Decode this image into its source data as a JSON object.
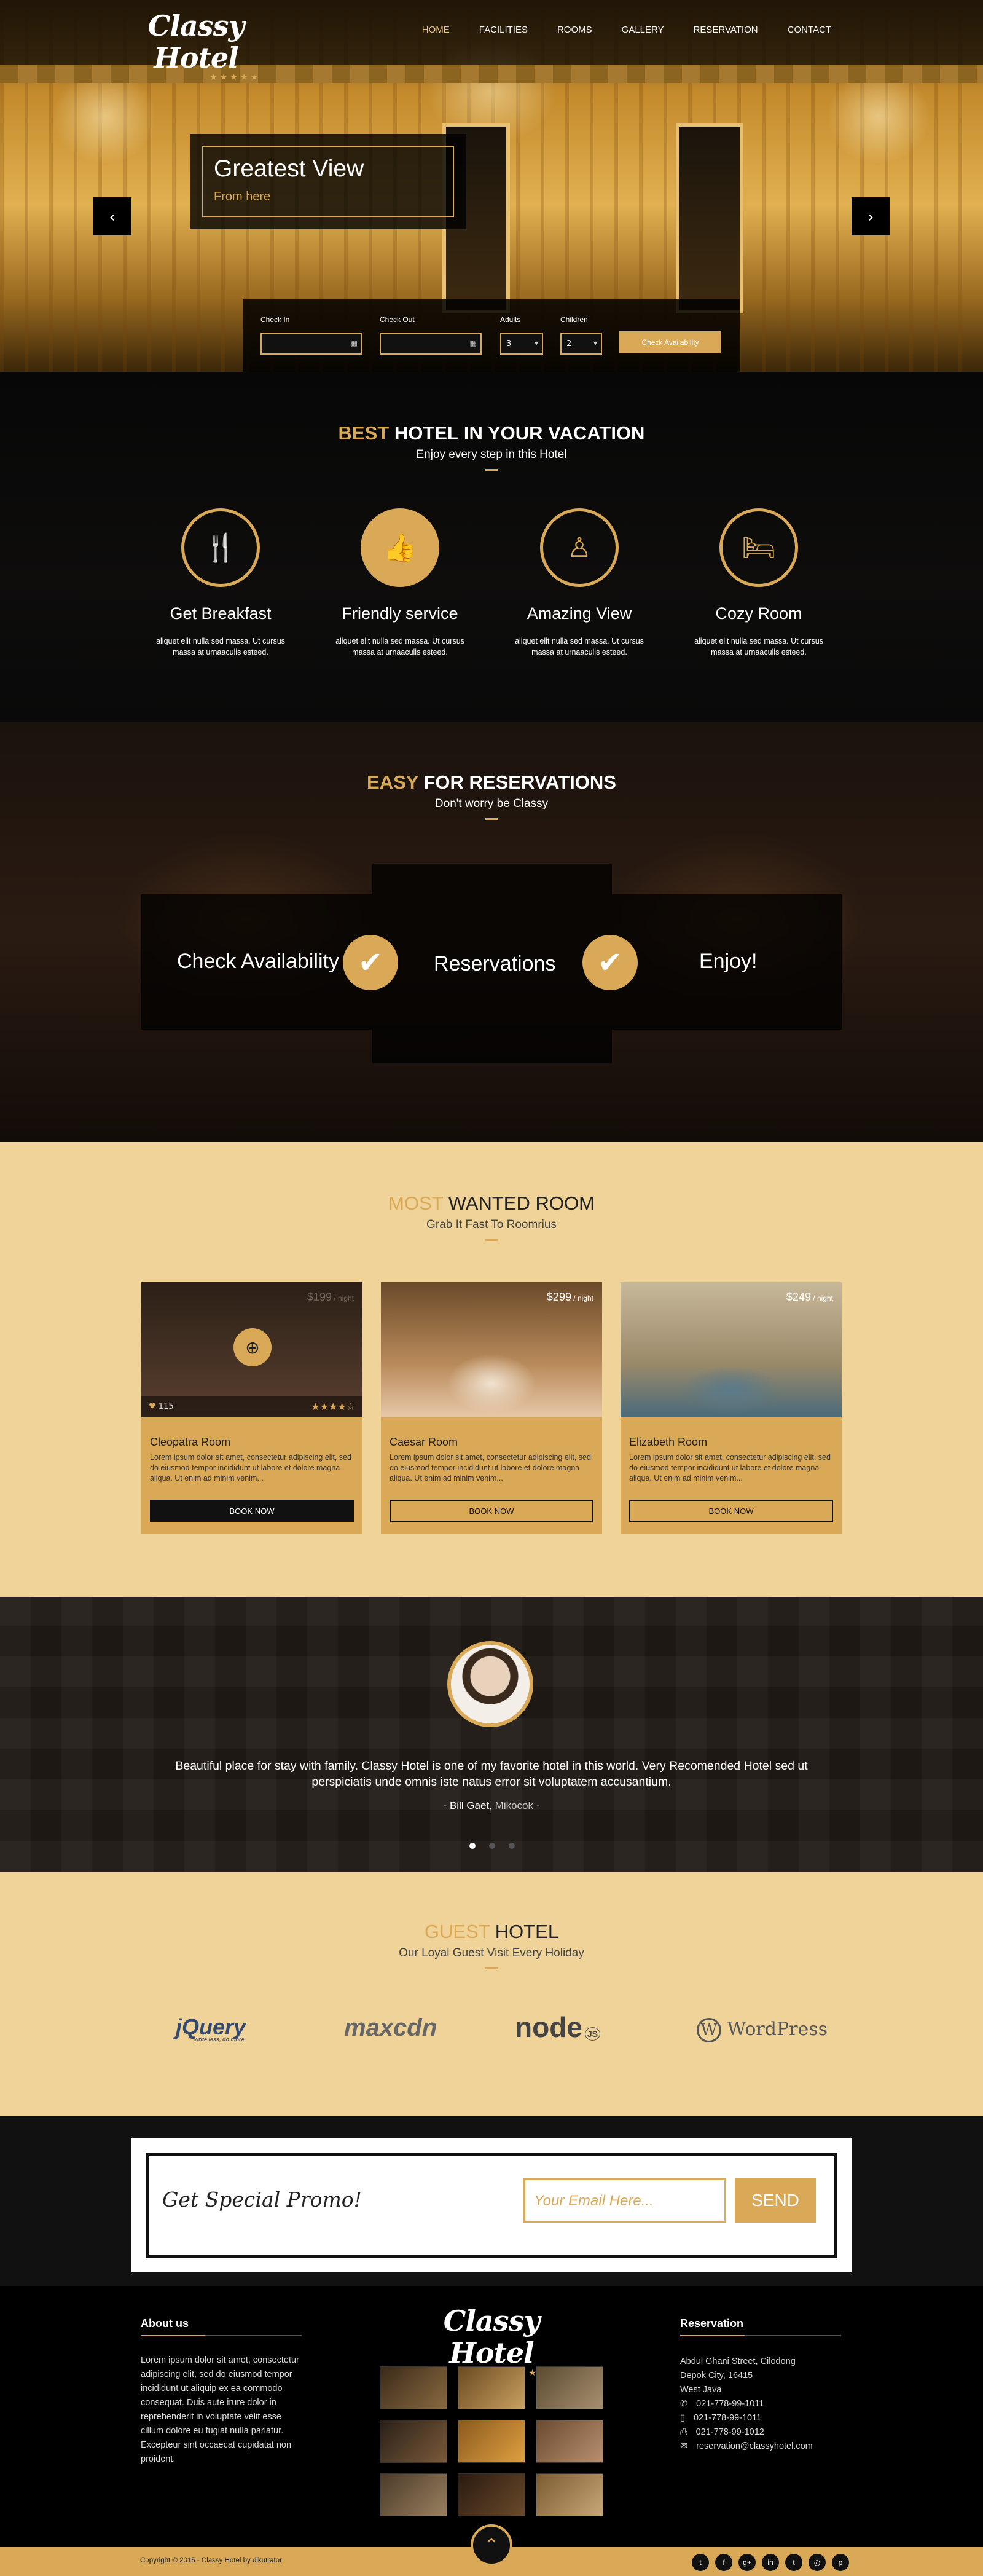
{
  "header": {
    "logo": "Classy Hotel",
    "logo_stars": "★★★★★",
    "nav": [
      "HOME",
      "FACILITIES",
      "ROOMS",
      "GALLERY",
      "RESERVATION",
      "CONTACT"
    ]
  },
  "hero": {
    "title": "Greatest View",
    "subtitle": "From here",
    "prev_icon": "‹",
    "next_icon": "›",
    "booking": {
      "checkin_label": "Check In",
      "checkout_label": "Check Out",
      "adults_label": "Adults",
      "adults_value": "3",
      "children_label": "Children",
      "children_value": "2",
      "button": "Check Availability"
    }
  },
  "best": {
    "title_accent": "BEST",
    "title_rest": " HOTEL IN YOUR VACATION",
    "subtitle": "Enjoy every step in this Hotel",
    "features": [
      {
        "icon": "cutlery-icon",
        "glyph": "🍴",
        "title": "Get Breakfast",
        "text": "aliquet elit nulla sed massa. Ut cursus massa at urnaaculis esteed."
      },
      {
        "icon": "thumbs-up-icon",
        "glyph": "👍",
        "title": "Friendly service",
        "text": "aliquet elit nulla sed massa. Ut cursus massa at urnaaculis esteed."
      },
      {
        "icon": "viewpoint-icon",
        "glyph": "♙",
        "title": "Amazing View",
        "text": "aliquet elit nulla sed massa. Ut cursus massa at urnaaculis esteed."
      },
      {
        "icon": "bed-icon",
        "glyph": "🛏",
        "title": "Cozy Room",
        "text": "aliquet elit nulla sed massa. Ut cursus massa at urnaaculis esteed."
      }
    ]
  },
  "easy": {
    "title_accent": "EASY",
    "title_rest": " FOR RESERVATIONS",
    "subtitle": "Don't worry be Classy",
    "steps": [
      "Check Availability",
      "Reservations",
      "Enjoy!"
    ]
  },
  "rooms": {
    "title_accent": "MOST",
    "title_rest": " WANTED ROOM",
    "subtitle": "Grab It Fast To Roomrius",
    "items": [
      {
        "name": "Cleopatra Room",
        "price": "$199",
        "per": " / night",
        "likes": "115",
        "rating": 4,
        "text": "Lorem ipsum dolor sit amet, consectetur adipiscing elit, sed do eiusmod tempor incididunt ut labore et dolore magna aliqua. Ut enim ad minim venim...",
        "button": "BOOK NOW",
        "color_top": "#2b1f16",
        "color_bottom": "#5a4030"
      },
      {
        "name": "Caesar Room",
        "price": "$299",
        "per": " / night",
        "text": "Lorem ipsum dolor sit amet, consectetur adipiscing elit, sed do eiusmod tempor incididunt ut labore et dolore magna aliqua. Ut enim ad minim venim...",
        "button": "BOOK NOW",
        "color_top": "#6b4a2a",
        "color_bottom": "#e8c8a8"
      },
      {
        "name": "Elizabeth Room",
        "price": "$249",
        "per": " / night",
        "text": "Lorem ipsum dolor sit amet, consectetur adipiscing elit, sed do eiusmod tempor incididunt ut labore et dolore magna aliqua. Ut enim ad minim venim...",
        "button": "BOOK NOW",
        "color_top": "#c8b89a",
        "color_bottom": "#4a6a7a"
      }
    ]
  },
  "testimonial": {
    "text": "Beautiful place for stay with family. Classy Hotel is one of my favorite hotel in this world. Very Recomended Hotel sed ut perspiciatis unde omnis iste natus error sit voluptatem accusantium.",
    "author_name": "- Bill Gaet,",
    "author_place": " Mikocok -"
  },
  "guest": {
    "title_accent": "GUEST",
    "title_rest": " HOTEL",
    "subtitle": "Our Loyal Guest Visit Every Holiday",
    "brands": [
      "jQuery",
      "maxcdn",
      "node",
      "WordPress"
    ],
    "jquery_tag": "write less, do more.",
    "node_tag": "JS"
  },
  "promo": {
    "title": "Get Special Promo!",
    "placeholder": "Your Email Here...",
    "button": "SEND"
  },
  "footer": {
    "about_title": "About us",
    "about_text": "Lorem ipsum dolor sit amet, consectetur adipiscing elit, sed do eiusmod tempor incididunt ut aliquip ex ea commodo consequat. Duis aute irure dolor in reprehenderit in voluptate velit esse cillum dolore eu fugiat nulla pariatur. Excepteur sint occaecat cupidatat non proident.",
    "logo": "Classy Hotel",
    "reservation_title": "Reservation",
    "address": [
      "Abdul Ghani Street, Cilodong",
      "Depok City, 16415",
      "West Java"
    ],
    "phone1": "021-778-99-1011",
    "phone2": "021-778-99-1011",
    "fax": "021-778-99-1012",
    "email": "reservation@classyhotel.com",
    "copyright": "Copyright © 2015 - Classy Hotel by dikutrator",
    "socials": [
      "t",
      "f",
      "g+",
      "in",
      "t",
      "◎",
      "p"
    ],
    "up_icon": "⌃"
  },
  "colors": {
    "accent": "#d9a957",
    "sand": "#f0d399",
    "dark": "#111111"
  }
}
